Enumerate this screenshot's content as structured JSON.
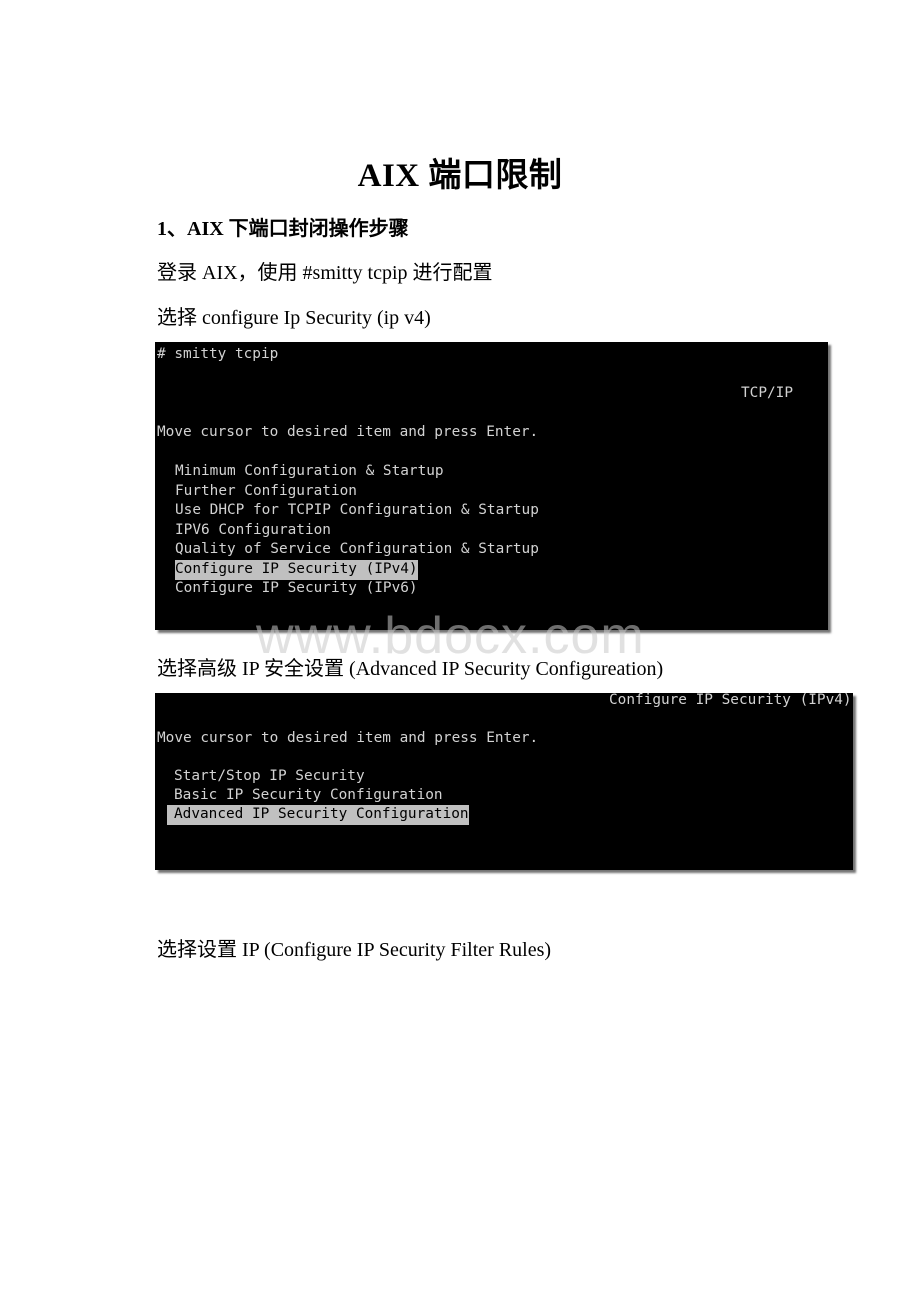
{
  "document": {
    "title": "AIX 端口限制",
    "section_heading": "1、AIX 下端口封闭操作步骤",
    "paragraphs": [
      "登录 AIX，使用 #smitty tcpip 进行配置",
      "选择 configure Ip Security (ip v4)",
      "选择高级 IP 安全设置 (Advanced IP Security Configureation)",
      "选择设置 IP (Configure IP Security Filter Rules)"
    ],
    "watermark": "www.bdocx.com"
  },
  "terminal1": {
    "command": "# smitty tcpip",
    "screen_title": "TCP/IP",
    "instruction": "Move cursor to desired item and press Enter.",
    "menu_items": [
      "Minimum Configuration & Startup",
      "Further Configuration",
      "Use DHCP for TCPIP Configuration & Startup",
      "IPV6 Configuration",
      "Quality of Service Configuration & Startup",
      "Configure IP Security (IPv4)",
      "Configure IP Security (IPv6)"
    ],
    "selected_index": 5
  },
  "terminal2": {
    "screen_title": "Configure IP Security (IPv4)",
    "instruction": "Move cursor to desired item and press Enter.",
    "menu_items": [
      "Start/Stop IP Security",
      "Basic IP Security Configuration",
      "Advanced IP Security Configuration"
    ],
    "selected_index": 2
  }
}
